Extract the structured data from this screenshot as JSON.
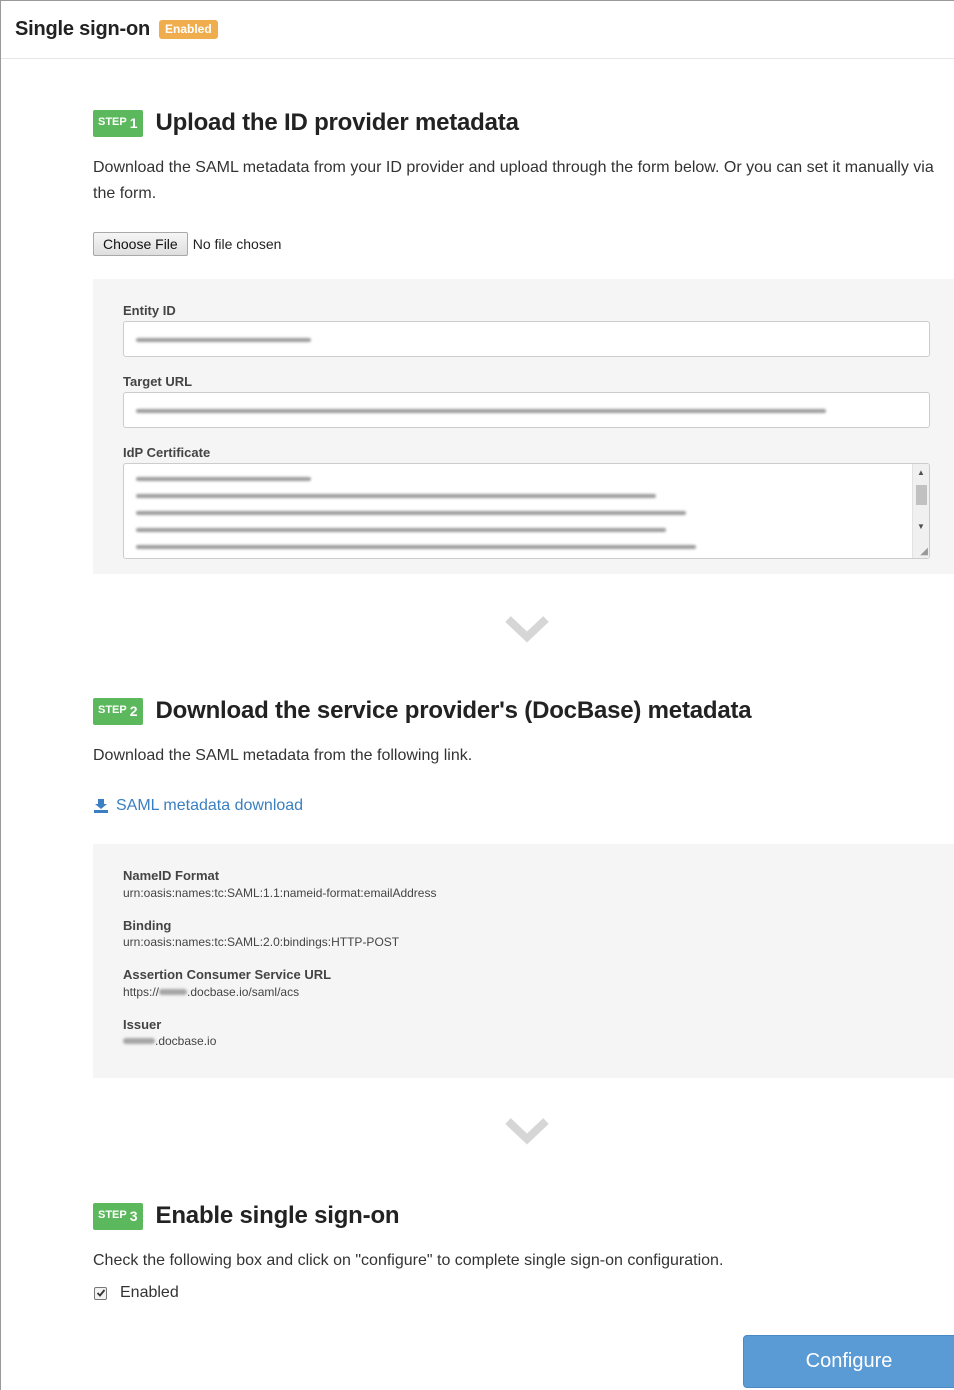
{
  "header": {
    "title": "Single sign-on",
    "badge": "Enabled",
    "badge_color": "#f0ad4e"
  },
  "step1": {
    "step_word": "STEP",
    "step_number": "1",
    "title": "Upload the ID provider metadata",
    "description": "Download the SAML metadata from your ID provider and upload through the form below. Or you can set it manually via the form.",
    "file_button": "Choose File",
    "file_status": "No file chosen",
    "fields": {
      "entity_id_label": "Entity ID",
      "target_url_label": "Target URL",
      "certificate_label": "IdP Certificate"
    }
  },
  "step2": {
    "step_word": "STEP",
    "step_number": "2",
    "title": "Download the service provider's (DocBase) metadata",
    "description": "Download the SAML metadata from the following link.",
    "link_text": "SAML metadata download",
    "metadata": {
      "nameid_label": "NameID Format",
      "nameid_value": "urn:oasis:names:tc:SAML:1.1:nameid-format:emailAddress",
      "binding_label": "Binding",
      "binding_value": "urn:oasis:names:tc:SAML:2.0:bindings:HTTP-POST",
      "acs_label": "Assertion Consumer Service URL",
      "acs_prefix": "https://",
      "acs_suffix": ".docbase.io/saml/acs",
      "issuer_label": "Issuer",
      "issuer_suffix": ".docbase.io"
    }
  },
  "step3": {
    "step_word": "STEP",
    "step_number": "3",
    "title": "Enable single sign-on",
    "description": "Check the following box and click on \"configure\" to complete single sign-on configuration.",
    "checkbox_label": "Enabled",
    "checkbox_checked": true,
    "button_label": "Configure"
  },
  "colors": {
    "step_green": "#5cb85c",
    "link_blue": "#3a7fc1",
    "button_blue": "#5b9bd5",
    "panel_bg": "#f5f5f5"
  }
}
